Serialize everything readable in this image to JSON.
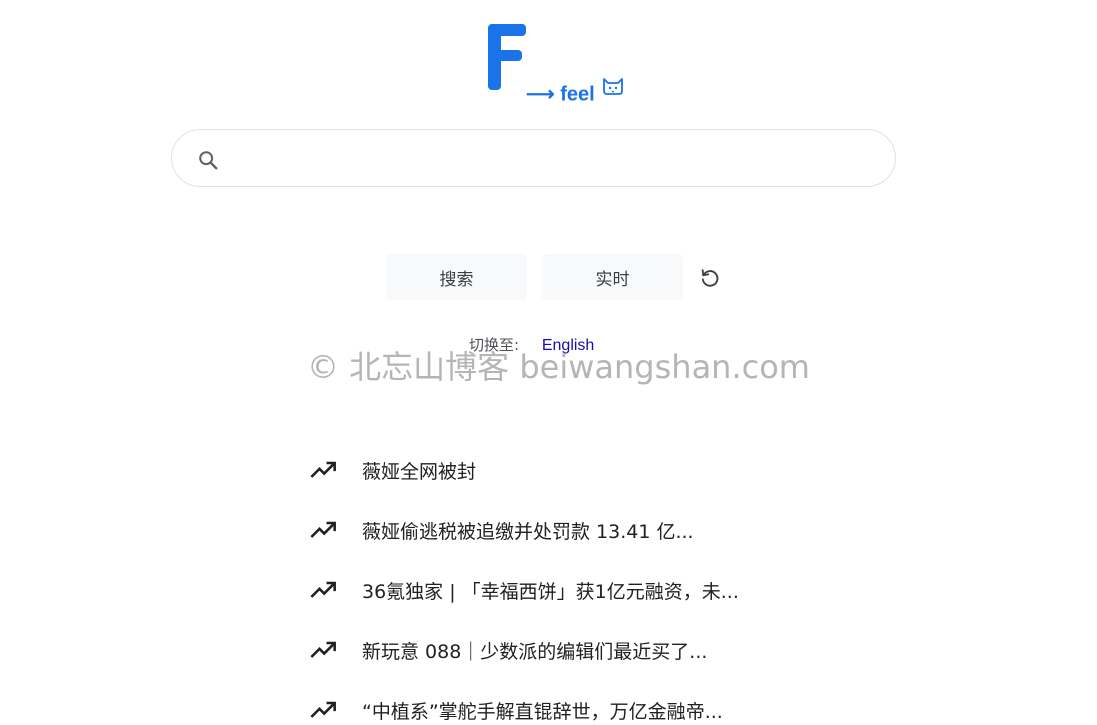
{
  "logo": {
    "letter": "F",
    "tagline": "⟶ feel",
    "icon": "cat-face-icon",
    "color": "#1a73e8"
  },
  "search": {
    "value": "",
    "placeholder": "",
    "icon": "search-icon"
  },
  "buttons": {
    "search_label": "搜索",
    "realtime_label": "实时",
    "refresh_icon": "refresh-icon"
  },
  "language": {
    "label": "切换至:",
    "link": "English"
  },
  "watermark": "© 北忘山博客 beiwangshan.com",
  "trending": {
    "icon": "trending-up-icon",
    "items": [
      "薇娅全网被封",
      "薇娅偷逃税被追缴并处罚款 13.41 亿...",
      "36氪独家 | 「幸福西饼」获1亿元融资，未...",
      "新玩意 088｜少数派的编辑们最近买了...",
      "“中植系”掌舵手解直锟辞世，万亿金融帝..."
    ]
  }
}
